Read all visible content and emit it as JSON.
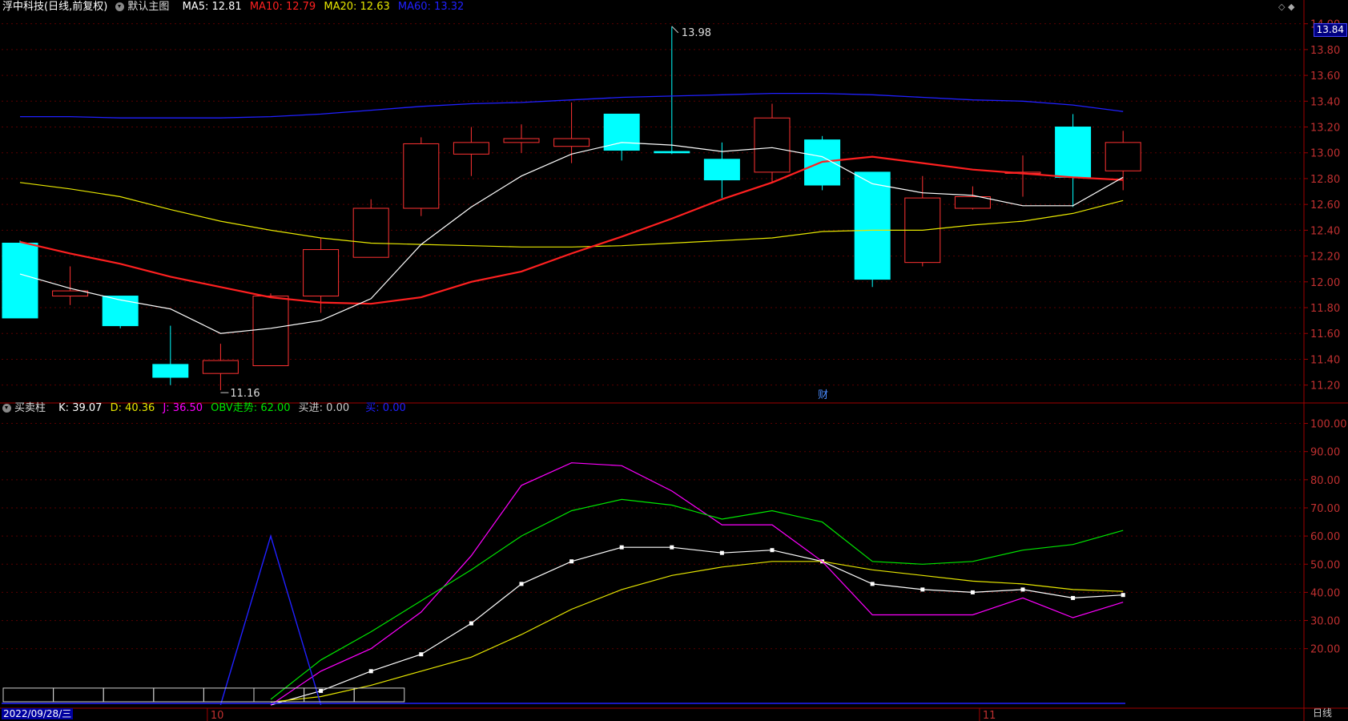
{
  "main_legend": {
    "stock_name": "浮中科技(日线,前复权)",
    "template": "默认主图",
    "ma5": "MA5: 12.81",
    "ma10": "MA10: 12.79",
    "ma20": "MA20: 12.63",
    "ma60": "MA60: 13.32"
  },
  "sub_legend": {
    "indicator": "买卖柱",
    "k": "K: 39.07",
    "d": "D: 40.36",
    "j": "J: 36.50",
    "obv": "OBV走势: 62.00",
    "buy": "买进: 0.00",
    "sell": "买: 0.00"
  },
  "current_price": "13.84",
  "cursor_date": "2022/09/28/三",
  "period": "日线",
  "corner_icons": "◇ ◆",
  "colors": {
    "up": "#ff3232",
    "down": "#00ffff",
    "ma5": "#ffffff",
    "ma10": "#ff2020",
    "ma20": "#e6e600",
    "ma60": "#2020ff",
    "k": "#ffffff",
    "d": "#e6e600",
    "j": "#ff00ff",
    "obv": "#00e600",
    "axis": "#a00000"
  },
  "chart_data": [
    {
      "type": "candlestick",
      "title": "浮中科技(日线,前复权)",
      "ylim": [
        11.08,
        14.06
      ],
      "yticks": [
        11.2,
        11.4,
        11.6,
        11.8,
        12.0,
        12.2,
        12.4,
        12.6,
        12.8,
        13.0,
        13.2,
        13.4,
        13.6,
        13.8,
        14.0
      ],
      "x_labels": [
        "10",
        "11"
      ],
      "candles": [
        {
          "o": 12.3,
          "h": 12.32,
          "l": 11.72,
          "c": 11.72
        },
        {
          "o": 11.89,
          "h": 12.12,
          "l": 11.82,
          "c": 11.93
        },
        {
          "o": 11.89,
          "h": 11.89,
          "l": 11.64,
          "c": 11.66
        },
        {
          "o": 11.36,
          "h": 11.66,
          "l": 11.2,
          "c": 11.26
        },
        {
          "o": 11.29,
          "h": 11.52,
          "l": 11.16,
          "c": 11.39
        },
        {
          "o": 11.35,
          "h": 11.91,
          "l": 11.35,
          "c": 11.89
        },
        {
          "o": 11.89,
          "h": 12.34,
          "l": 11.76,
          "c": 12.25
        },
        {
          "o": 12.19,
          "h": 12.64,
          "l": 12.19,
          "c": 12.57
        },
        {
          "o": 12.57,
          "h": 13.12,
          "l": 12.51,
          "c": 13.07
        },
        {
          "o": 12.99,
          "h": 13.2,
          "l": 12.82,
          "c": 13.08
        },
        {
          "o": 13.08,
          "h": 13.22,
          "l": 13.0,
          "c": 13.11
        },
        {
          "o": 13.05,
          "h": 13.39,
          "l": 12.92,
          "c": 13.11
        },
        {
          "o": 13.3,
          "h": 13.3,
          "l": 12.94,
          "c": 13.02
        },
        {
          "o": 13.01,
          "h": 13.98,
          "l": 12.99,
          "c": 13.0
        },
        {
          "o": 12.95,
          "h": 13.08,
          "l": 12.65,
          "c": 12.79
        },
        {
          "o": 12.85,
          "h": 13.38,
          "l": 12.77,
          "c": 13.27
        },
        {
          "o": 13.1,
          "h": 13.13,
          "l": 12.71,
          "c": 12.75
        },
        {
          "o": 12.85,
          "h": 12.85,
          "l": 11.96,
          "c": 12.02
        },
        {
          "o": 12.15,
          "h": 12.82,
          "l": 12.12,
          "c": 12.65
        },
        {
          "o": 12.57,
          "h": 12.74,
          "l": 12.56,
          "c": 12.66
        },
        {
          "o": 12.85,
          "h": 12.98,
          "l": 12.66,
          "c": 12.85
        },
        {
          "o": 13.2,
          "h": 13.3,
          "l": 12.58,
          "c": 12.81
        },
        {
          "o": 12.86,
          "h": 13.17,
          "l": 12.71,
          "c": 13.08
        }
      ],
      "ma5": [
        12.06,
        11.95,
        11.86,
        11.79,
        11.6,
        11.64,
        11.7,
        11.87,
        12.29,
        12.58,
        12.82,
        12.99,
        13.08,
        13.06,
        13.01,
        13.04,
        12.97,
        12.76,
        12.69,
        12.67,
        12.59,
        12.59,
        12.81
      ],
      "ma10": [
        12.31,
        12.22,
        12.14,
        12.04,
        11.96,
        11.88,
        11.84,
        11.83,
        11.88,
        12.0,
        12.08,
        12.22,
        12.35,
        12.49,
        12.64,
        12.77,
        12.93,
        12.97,
        12.92,
        12.87,
        12.84,
        12.81,
        12.79
      ],
      "ma20": [
        12.77,
        12.72,
        12.66,
        12.56,
        12.47,
        12.4,
        12.34,
        12.3,
        12.29,
        12.28,
        12.27,
        12.27,
        12.28,
        12.3,
        12.32,
        12.34,
        12.39,
        12.4,
        12.4,
        12.44,
        12.47,
        12.53,
        12.63
      ],
      "ma60": [
        13.28,
        13.28,
        13.27,
        13.27,
        13.27,
        13.28,
        13.3,
        13.33,
        13.36,
        13.38,
        13.39,
        13.41,
        13.43,
        13.44,
        13.45,
        13.46,
        13.46,
        13.45,
        13.43,
        13.41,
        13.4,
        13.37,
        13.32
      ],
      "annotations": [
        {
          "label": "13.98",
          "value": 13.98,
          "bar": 13
        },
        {
          "label": "11.16",
          "value": 11.16,
          "bar": 4
        },
        {
          "label": "财",
          "bar": 16
        }
      ]
    },
    {
      "type": "line",
      "title": "买卖柱",
      "ylim": [
        0,
        103
      ],
      "yticks": [
        20,
        30,
        40,
        50,
        60,
        70,
        80,
        90,
        100
      ],
      "series": [
        {
          "name": "K",
          "values": [
            null,
            null,
            null,
            null,
            null,
            0,
            5,
            12,
            18,
            29,
            43,
            51,
            56,
            56,
            54,
            55,
            51,
            43,
            41,
            40,
            41,
            38,
            39.07
          ]
        },
        {
          "name": "D",
          "values": [
            null,
            null,
            null,
            null,
            null,
            1,
            3,
            7,
            12,
            17,
            25,
            34,
            41,
            46,
            49,
            51,
            51,
            48,
            46,
            44,
            43,
            41,
            40.36
          ]
        },
        {
          "name": "J",
          "values": [
            null,
            null,
            null,
            null,
            null,
            0,
            12,
            20,
            33,
            53,
            78,
            86,
            85,
            76,
            64,
            64,
            51,
            32,
            32,
            32,
            38,
            31,
            36.5
          ]
        },
        {
          "name": "OBV走势",
          "values": [
            null,
            null,
            null,
            null,
            null,
            2,
            16,
            26,
            37,
            48,
            60,
            69,
            73,
            71,
            66,
            69,
            65,
            51,
            50,
            51,
            55,
            57,
            62.0
          ]
        },
        {
          "name": "买进",
          "values": [
            0,
            0,
            0,
            0,
            0,
            60,
            0,
            0,
            0,
            0,
            0,
            0,
            0,
            0,
            0,
            0,
            0,
            0,
            0,
            0,
            0,
            0,
            0.0
          ]
        }
      ],
      "buy_sell_bars": [
        6,
        6,
        6,
        6,
        6,
        6,
        6,
        6
      ]
    }
  ]
}
